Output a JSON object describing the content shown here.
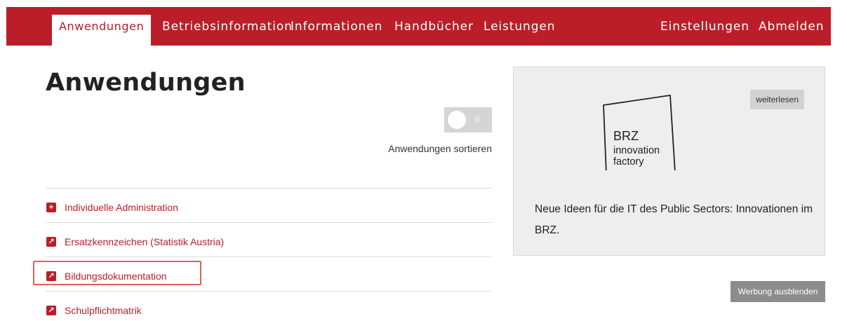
{
  "nav": {
    "active": "Anwendungen",
    "items": [
      "Betriebsinformation",
      "Informationen",
      "Handbücher",
      "Leistungen"
    ],
    "right": [
      "Einstellungen",
      "Abmelden"
    ]
  },
  "page": {
    "title": "Anwendungen",
    "toggle_text": "0",
    "sort_label": "Anwendungen sortieren"
  },
  "apps": [
    {
      "label": "Individuelle Administration",
      "icon": "plus-icon"
    },
    {
      "label": "Ersatzkennzeichen (Statistik Austria)",
      "icon": "external-link-icon"
    },
    {
      "label": "Bildungsdokumentation",
      "icon": "external-link-icon"
    },
    {
      "label": "Schulpflichtmatrik",
      "icon": "external-link-icon"
    }
  ],
  "promo": {
    "read_more": "weiterlesen",
    "logo": {
      "line1": "BRZ",
      "line2": "innovation",
      "line3": "factory"
    },
    "text": "Neue Ideen für die IT des Public Sectors: Innovationen im BRZ."
  },
  "hide_ads": "Werbung ausblenden",
  "colors": {
    "brand": "#bb1e28",
    "highlight": "#e0605c"
  }
}
